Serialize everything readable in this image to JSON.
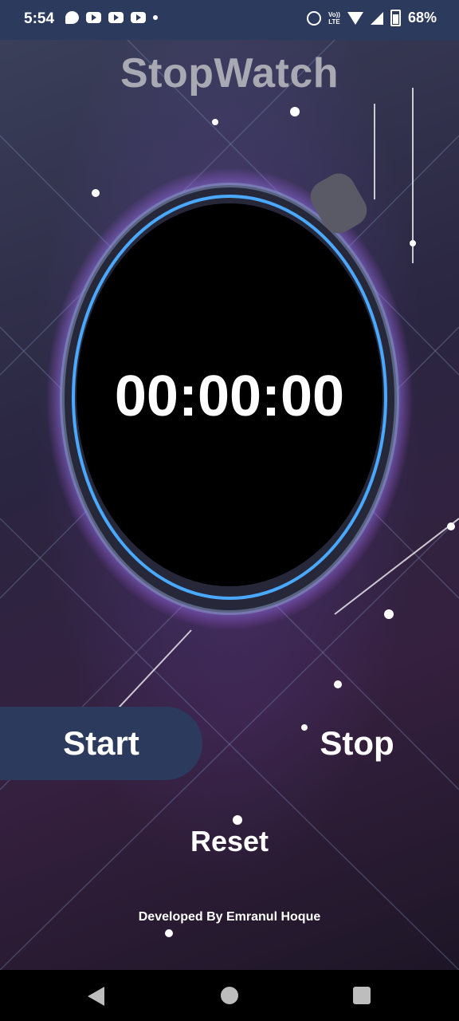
{
  "status_bar": {
    "time": "5:54",
    "volte_label": "Vo))\nLTE",
    "battery": "68%"
  },
  "app": {
    "title": "StopWatch",
    "timer": "00:00:00",
    "start_label": "Start",
    "stop_label": "Stop",
    "reset_label": "Reset",
    "credit": "Developed By Emranul Hoque"
  },
  "colors": {
    "status_bar_bg": "#2c3a5e",
    "start_button_bg": "#2c3a5e",
    "title_text": "#a9a9b3"
  },
  "icons": {
    "notifications": [
      "message-icon",
      "youtube-icon",
      "youtube-icon",
      "youtube-icon",
      "dot-icon"
    ],
    "status": [
      "alarm-icon",
      "volte-icon",
      "wifi-icon",
      "signal-icon",
      "battery-icon"
    ],
    "nav": [
      "back-icon",
      "home-icon",
      "recents-icon"
    ]
  }
}
